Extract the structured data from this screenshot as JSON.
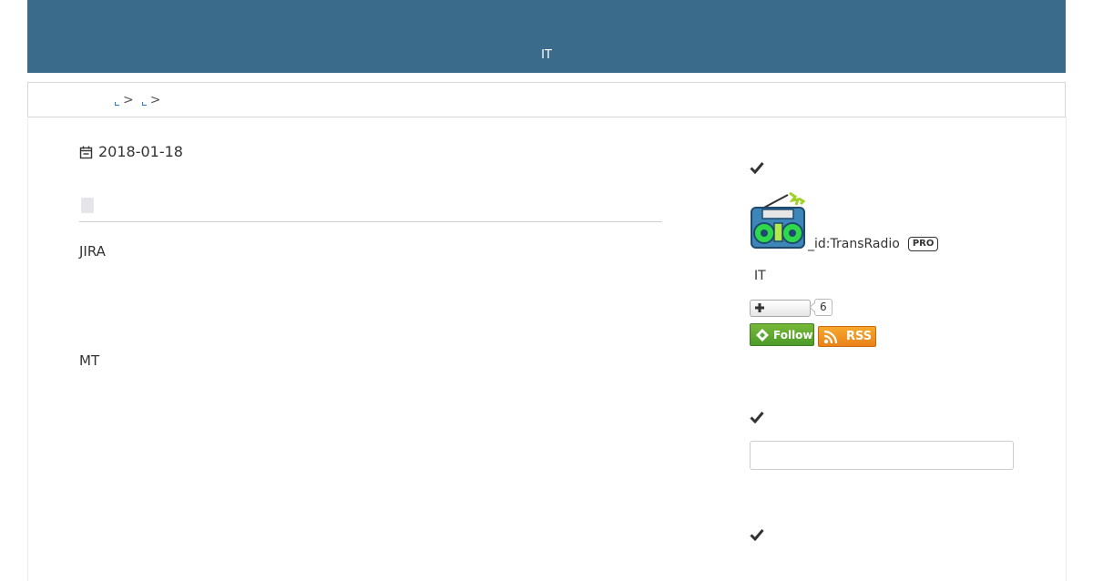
{
  "header": {
    "title": "IT"
  },
  "breadcrumb": {
    "separators": [
      ">",
      ">"
    ]
  },
  "entry": {
    "date": "2018-01-18",
    "paragraphs": [
      "JIRA",
      "MT"
    ]
  },
  "sidebar": {
    "profile": {
      "prefix": "_",
      "user_id": "id:TransRadio",
      "badge": "PRO",
      "description": "IT",
      "reader_count": "6",
      "follow_label": "Follow",
      "rss_label": "RSS"
    },
    "search": {
      "placeholder": "",
      "value": ""
    }
  },
  "colors": {
    "header_bg": "#3b6b8a",
    "follow_green": "#5aa630",
    "rss_orange": "#f39c1f",
    "link_blue": "#2a77c9"
  }
}
